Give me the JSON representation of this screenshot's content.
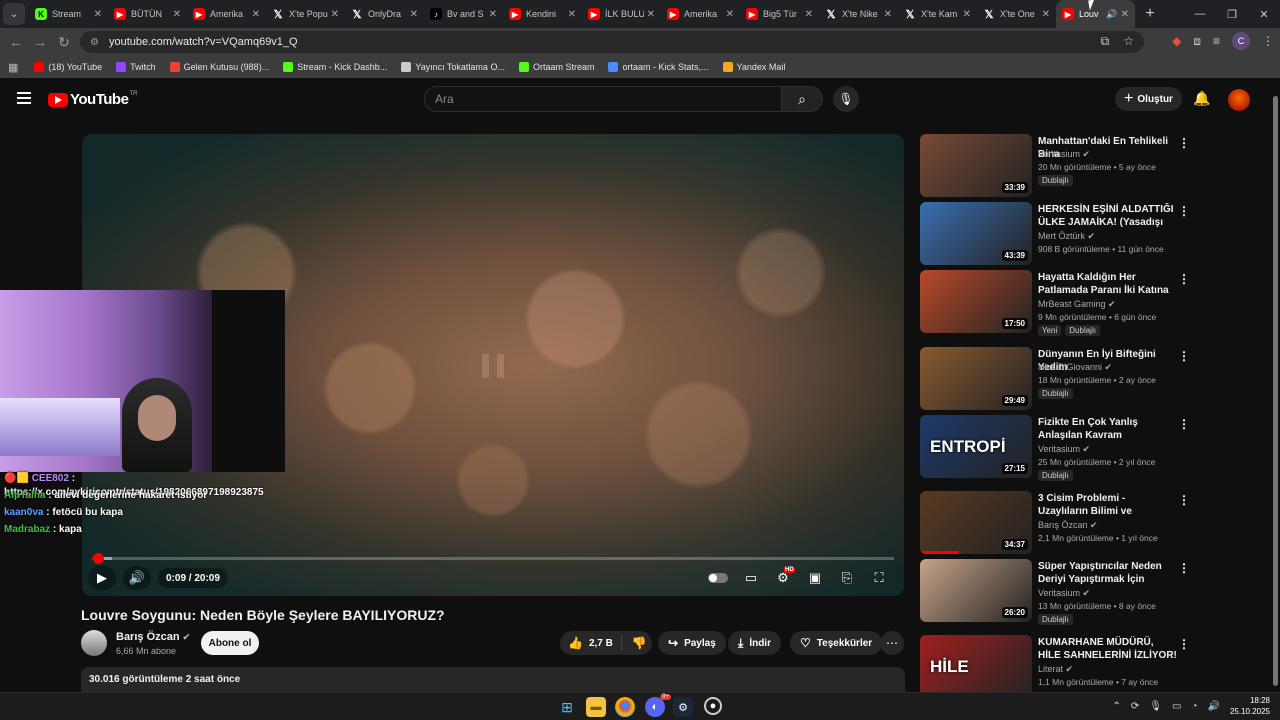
{
  "browser": {
    "tabs": [
      {
        "label": "Stream",
        "icon": "kick-icon"
      },
      {
        "label": "BÜTÜN",
        "icon": "youtube-icon"
      },
      {
        "label": "Amerika",
        "icon": "youtube-icon"
      },
      {
        "label": "X'te Popu",
        "icon": "x-icon"
      },
      {
        "label": "OnlyDra",
        "icon": "x-icon"
      },
      {
        "label": "Bv and S",
        "icon": "tiktok-icon"
      },
      {
        "label": "Kendini",
        "icon": "youtube-icon"
      },
      {
        "label": "İLK BULU",
        "icon": "youtube-icon"
      },
      {
        "label": "Amerika",
        "icon": "youtube-icon"
      },
      {
        "label": "Big5 Tür",
        "icon": "youtube-icon"
      },
      {
        "label": "X'te Nike",
        "icon": "x-icon"
      },
      {
        "label": "X'te Kam",
        "icon": "x-icon"
      },
      {
        "label": "X'te One",
        "icon": "x-icon"
      },
      {
        "label": "Louv",
        "icon": "youtube-icon",
        "active": true
      }
    ],
    "url": "youtube.com/watch?v=VQamq69v1_Q",
    "profile_initial": "C",
    "bookmarks": [
      {
        "label": "(18) YouTube",
        "color": "#ff0000"
      },
      {
        "label": "Twitch",
        "color": "#9146ff"
      },
      {
        "label": "Gelen Kutusu (988)...",
        "color": "#ea4335"
      },
      {
        "label": "Stream - Kick Dashb...",
        "color": "#53fc18"
      },
      {
        "label": "Yayıncı Tokatlama O...",
        "color": "#cccccc"
      },
      {
        "label": "Ortaam Stream",
        "color": "#53fc18"
      },
      {
        "label": "ortaam - Kick Stats,...",
        "color": "#4a8cff"
      },
      {
        "label": "Yandex Mail",
        "color": "#f5a623"
      }
    ]
  },
  "youtube": {
    "logo_text": "YouTube",
    "region": "TR",
    "search_placeholder": "Ara",
    "create_label": "Oluştur"
  },
  "player": {
    "time": "0:09 / 20:09",
    "progress": 0.007,
    "buffered": 0.025,
    "hd_badge": "HD"
  },
  "overlay_chat": [
    {
      "user": "CEE802",
      "text": ": https://x.com/aykiricomtr/status/1982066897198923875"
    },
    {
      "user": "AlpTalha",
      "text": ": ailevi değerlerine hakaret istiyor"
    },
    {
      "user": "kaan0va",
      "text": ": fetöcü bu kapa"
    },
    {
      "user": "Madrabaz",
      "text": ": kapa"
    }
  ],
  "video": {
    "title": "Louvre Soygunu: Neden Böyle Şeylere BAYILIYORUZ?",
    "channel": "Barış Özcan",
    "subscribers": "6,66 Mn abone",
    "subscribe_label": "Abone ol",
    "likes": "2,7 B",
    "share_label": "Paylaş",
    "download_label": "İndir",
    "thanks_label": "Teşekkürler",
    "views_date": "30.016 görüntüleme  2 saat önce"
  },
  "recommendations": [
    {
      "title": "Manhattan'daki En Tehlikeli Bina",
      "channel": "Veritasium",
      "meta": "20 Mn görüntüleme • 5 ay önce",
      "duration": "33:39",
      "badges": [
        "Dublajlı"
      ],
      "thumb": "#7a4a35",
      "progress": 0
    },
    {
      "title": "HERKESİN EŞİNİ ALDATTIĞI ÜLKE JAMAİKA! (Yasadışı Bir ...",
      "channel": "Mert Öztürk",
      "meta": "908 B görüntüleme • 11 gün önce",
      "duration": "43:39",
      "badges": [],
      "thumb": "#3a6fb0",
      "progress": 0
    },
    {
      "title": "Hayatta Kaldığın Her Patlamada Paranı İki Katına Çıkar",
      "channel": "MrBeast Gaming",
      "meta": "9 Mn görüntüleme • 6 gün önce",
      "duration": "17:50",
      "badges": [
        "Yeni",
        "Dublajlı"
      ],
      "thumb": "#b84a2a",
      "progress": 0
    },
    {
      "title": "Dünyanın En İyi Bifteğini Yedim",
      "channel": "Nick DiGiovanni",
      "meta": "18 Mn görüntüleme • 2 ay önce",
      "duration": "29:49",
      "badges": [
        "Dublajlı"
      ],
      "thumb": "#8a5a30",
      "progress": 0
    },
    {
      "title": "Fizikte En Çok Yanlış Anlaşılan Kavram",
      "channel": "Veritasium",
      "meta": "25 Mn görüntüleme • 2 yıl önce",
      "duration": "27:15",
      "badges": [
        "Dublajlı"
      ],
      "thumb": "#1e3a6a",
      "overlay": "ENTROPİ",
      "progress": 0
    },
    {
      "title": "3 Cisim Problemi - Uzaylıların Bilimi ve Teknolojisi",
      "channel": "Barış Özcan",
      "meta": "2,1 Mn görüntüleme • 1 yıl önce",
      "duration": "34:37",
      "badges": [],
      "thumb": "#5a3a20",
      "progress": 0.35
    },
    {
      "title": "Süper Yapıştırıcılar Neden Deriyi Yapıştırmak İçin Mükemmel",
      "channel": "Veritasium",
      "meta": "13 Mn görüntüleme • 8 ay önce",
      "duration": "26:20",
      "badges": [
        "Dublajlı"
      ],
      "thumb": "#c8a48a",
      "progress": 0
    },
    {
      "title": "KUMARHANE MÜDÜRÜ, HİLE SAHNELERİNİ İZLİYOR! ...",
      "channel": "Literat",
      "meta": "1,1 Mn görüntüleme • 7 ay önce",
      "duration": "",
      "badges": [],
      "thumb": "#a02020",
      "overlay": "HİLE",
      "progress": 0
    }
  ],
  "taskbar": {
    "time": "18:28",
    "date": "25.10.2025",
    "discord_badge": "9+"
  }
}
